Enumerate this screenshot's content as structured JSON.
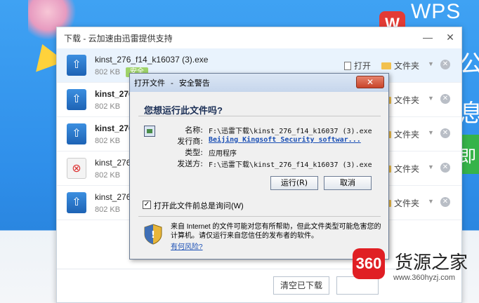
{
  "background": {
    "wps_logo": "WPS O",
    "chars": [
      "公",
      "息",
      "即"
    ]
  },
  "download_window": {
    "title": "下载 - 云加速由迅雷提供支持",
    "rows": [
      {
        "name": "kinst_276_f14_k16037 (3).exe",
        "size": "802 KB",
        "badge": "安全",
        "open": "打开",
        "folder": "文件夹"
      },
      {
        "name": "kinst_276",
        "size": "802 KB",
        "badge": "",
        "open": "",
        "folder": "文件夹"
      },
      {
        "name": "kinst_276",
        "size": "802 KB",
        "badge": "",
        "open": "",
        "folder": "文件夹"
      },
      {
        "name": "kinst_276",
        "size": "802 KB",
        "badge": "",
        "open": "",
        "folder": "文件夹"
      },
      {
        "name": "kinst_276",
        "size": "802 KB",
        "badge": "",
        "open": "",
        "folder": "文件夹"
      }
    ],
    "clear_button": "清空已下载"
  },
  "security_dialog": {
    "title": "打开文件 - 安全警告",
    "question": "您想运行此文件吗?",
    "fields": [
      {
        "label": "名称:",
        "value": "F:\\迅雷下载\\kinst_276_f14_k16037 (3).exe"
      },
      {
        "label": "发行商:",
        "value": "Beijing Kingsoft Security softwar..."
      },
      {
        "label": "类型:",
        "value": "应用程序"
      },
      {
        "label": "发送方:",
        "value": "F:\\迅雷下载\\kinst_276_f14_k16037 (3).exe"
      }
    ],
    "run_button": "运行(R)",
    "cancel_button": "取消",
    "checkbox_label": "打开此文件前总是询问(W)",
    "checkbox_checked": true,
    "warning_text": "来自 Internet 的文件可能对您有所帮助，但此文件类型可能危害您的计算机。请仅运行来自您信任的发布者的软件。",
    "risk_link": "有何风险?"
  },
  "watermark": {
    "logo": "360",
    "name": "货源之家",
    "url": "www.360hyzj.com"
  }
}
